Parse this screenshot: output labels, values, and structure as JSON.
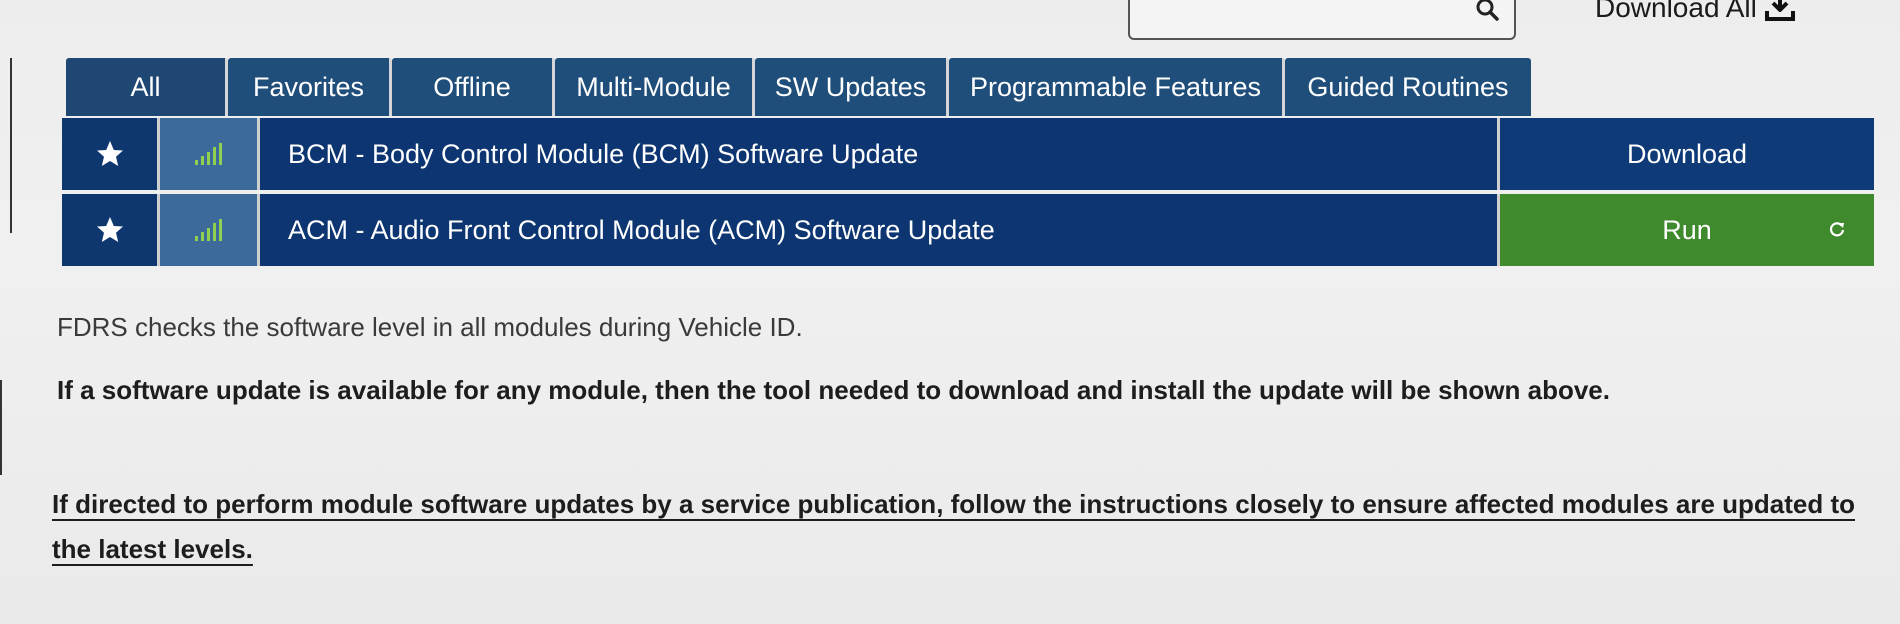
{
  "header": {
    "download_all_label": "Download All"
  },
  "tabs": [
    {
      "label": "All"
    },
    {
      "label": "Favorites"
    },
    {
      "label": "Offline"
    },
    {
      "label": "Multi-Module"
    },
    {
      "label": "SW Updates"
    },
    {
      "label": "Programmable Features"
    },
    {
      "label": "Guided Routines"
    }
  ],
  "routines": [
    {
      "name": "BCM - Body Control Module (BCM) Software Update",
      "action": "Download",
      "action_color": "#0f3a78"
    },
    {
      "name": "ACM - Audio Front Control Module (ACM) Software Update",
      "action": "Run",
      "action_color": "#3e8a2c"
    }
  ],
  "info": {
    "line1": "FDRS checks the software level in all modules during Vehicle ID.",
    "line2": "If a software update is available for any module, then the tool needed to download and install the update will be shown above.",
    "line3": "If directed to perform module software updates by a service publication, follow the instructions closely to ensure affected modules are updated to the latest levels."
  },
  "icons": {
    "search": "search-icon",
    "download_all": "download-tray-icon",
    "favorite": "star-icon",
    "signal": "signal-bars-icon",
    "refresh": "refresh-icon"
  },
  "colors": {
    "tab_bg": "#1f4e7a",
    "row_bg": "#0d3571",
    "signal_cell_bg": "#3c6a9b",
    "signal_bars": "#8fd14f",
    "run_bg": "#3e8a2c"
  }
}
